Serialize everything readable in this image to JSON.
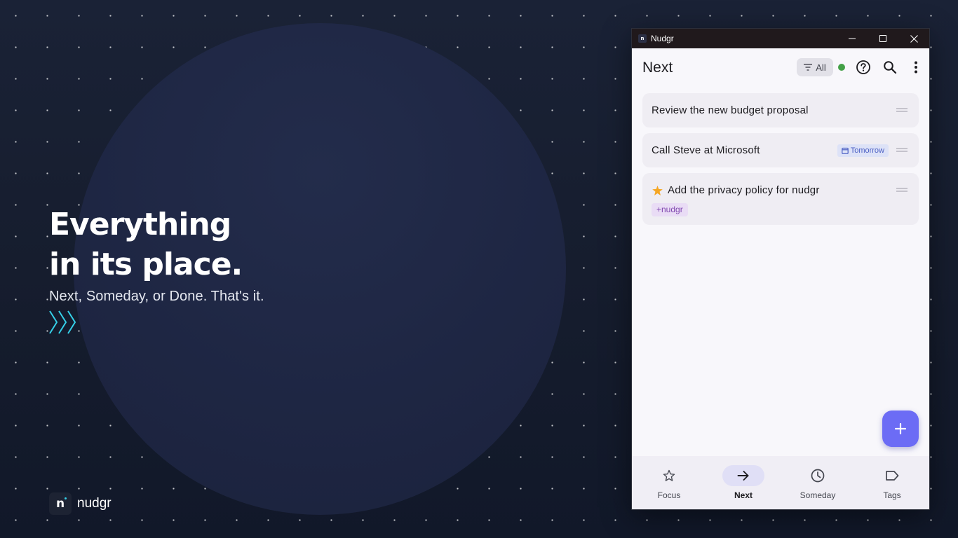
{
  "hero": {
    "title_line1": "Everything",
    "title_line2": "in its place.",
    "subtitle": "Next, Someday, or Done. That's it."
  },
  "brand": {
    "logo_letter": "n",
    "name": "nudgr"
  },
  "window": {
    "title": "Nudgr",
    "icon_letter": "n"
  },
  "appbar": {
    "title": "Next",
    "filter_label": "All",
    "status_color": "#43a047"
  },
  "tasks": [
    {
      "title": "Review the new budget proposal"
    },
    {
      "title": "Call Steve at Microsoft",
      "due": "Tomorrow"
    },
    {
      "title": "Add the privacy policy for nudgr",
      "starred": true,
      "tag": "+nudgr"
    }
  ],
  "fab": {
    "icon": "plus-icon"
  },
  "nav": {
    "items": [
      {
        "label": "Focus",
        "icon": "star-icon"
      },
      {
        "label": "Next",
        "icon": "arrow-right-icon",
        "active": true
      },
      {
        "label": "Someday",
        "icon": "clock-icon"
      },
      {
        "label": "Tags",
        "icon": "tag-icon"
      }
    ]
  },
  "colors": {
    "accent": "#6c6cf5",
    "background": "#161d2e",
    "chevron": "#35d0e8",
    "star": "#f5a623",
    "tag_text": "#8148b0",
    "date_text": "#4b5fc4"
  }
}
